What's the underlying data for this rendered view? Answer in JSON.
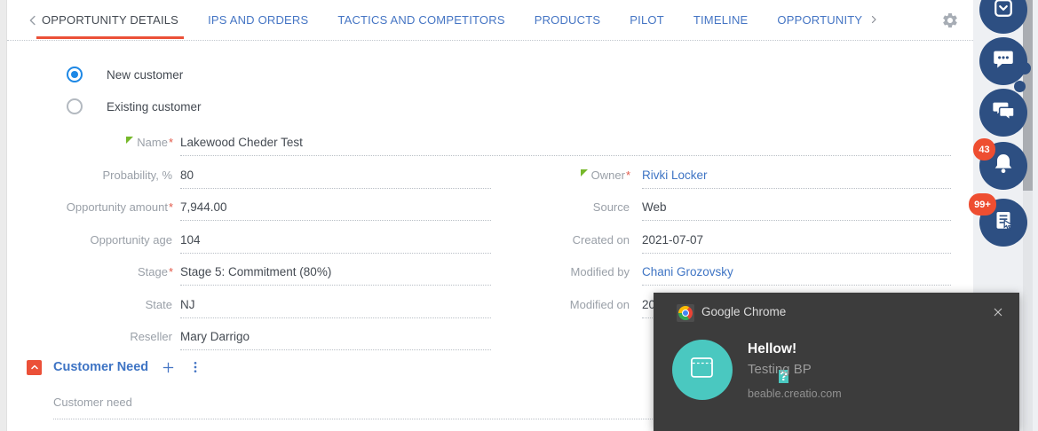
{
  "colors": {
    "accent_orange": "#eb5038",
    "tab_blue": "#4575c4",
    "link_blue": "#3e74c4",
    "navy_button": "#2d4f82",
    "badge_red": "#ee4e31",
    "teal": "#4ac8c0",
    "radio_blue": "#1e88e5",
    "notification_bg": "#3c3c3c"
  },
  "tabbar": {
    "tabs": [
      {
        "label": "OPPORTUNITY DETAILS",
        "active": true
      },
      {
        "label": "IPS AND ORDERS",
        "active": false
      },
      {
        "label": "TACTICS AND COMPETITORS",
        "active": false
      },
      {
        "label": "PRODUCTS",
        "active": false
      },
      {
        "label": "PILOT",
        "active": false
      },
      {
        "label": "TIMELINE",
        "active": false
      },
      {
        "label": "OPPORTUNITY",
        "active": false,
        "overflow": true
      }
    ]
  },
  "customer_type": {
    "options": [
      {
        "label": "New customer",
        "selected": true
      },
      {
        "label": "Existing customer",
        "selected": false
      }
    ]
  },
  "fields": {
    "name": {
      "label": "Name",
      "req": "*",
      "value": "Lakewood Cheder Test",
      "changed": true
    },
    "left": [
      {
        "label": "Probability, %",
        "req": "",
        "value": "80"
      },
      {
        "label": "Opportunity amount",
        "req": "*",
        "value": "7,944.00"
      },
      {
        "label": "Opportunity age",
        "req": "",
        "value": "104"
      },
      {
        "label": "Stage",
        "req": "*",
        "value": "Stage 5: Commitment (80%)"
      },
      {
        "label": "State",
        "req": "",
        "value": "NJ"
      },
      {
        "label": "Reseller",
        "req": "",
        "value": "Mary Darrigo"
      }
    ],
    "right": [
      {
        "label": "Owner",
        "req": "*",
        "value": "Rivki Locker",
        "link": true,
        "changed": true
      },
      {
        "label": "Source",
        "req": "",
        "value": "Web"
      },
      {
        "label": "Created on",
        "req": "",
        "value": "2021-07-07"
      },
      {
        "label": "Modified by",
        "req": "",
        "value": "Chani Grozovsky",
        "link": true
      },
      {
        "label": "Modified on",
        "req": "",
        "value": "20"
      }
    ]
  },
  "customer_need": {
    "title": "Customer Need",
    "field_label": "Customer need"
  },
  "side_buttons": {
    "bell_badge": "43",
    "feed_badge": "99+"
  },
  "notification": {
    "app_name": "Google Chrome",
    "title": "Hellow!",
    "body": "Testing BP",
    "source": "beable.creatio.com",
    "icon_glyph": "?"
  }
}
